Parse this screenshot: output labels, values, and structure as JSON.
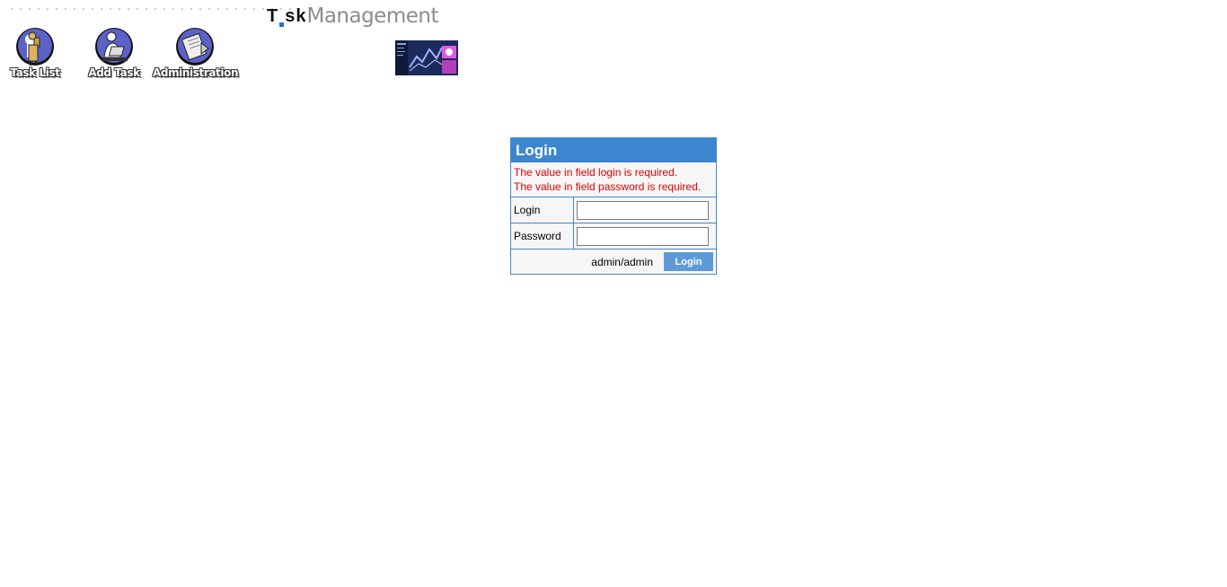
{
  "nav": {
    "items": [
      {
        "label": "Task List",
        "icon": "person-reading-icon"
      },
      {
        "label": "Add Task",
        "icon": "person-at-computer-icon"
      },
      {
        "label": "Administration",
        "icon": "clipboard-document-icon"
      }
    ]
  },
  "brand": {
    "task_text": "Tsk",
    "task_prefix": "T",
    "management_text": "Management"
  },
  "login": {
    "title": "Login",
    "errors": [
      "The value in field login is required.",
      "The value in field password is required."
    ],
    "login_label": "Login",
    "login_value": "",
    "password_label": "Password",
    "password_value": "",
    "hint": "admin/admin",
    "button_label": "Login"
  },
  "colors": {
    "header_blue": "#3d86cf",
    "border_blue": "#4a86c8",
    "button_blue": "#5e9ad9",
    "error_red": "#e00000"
  }
}
